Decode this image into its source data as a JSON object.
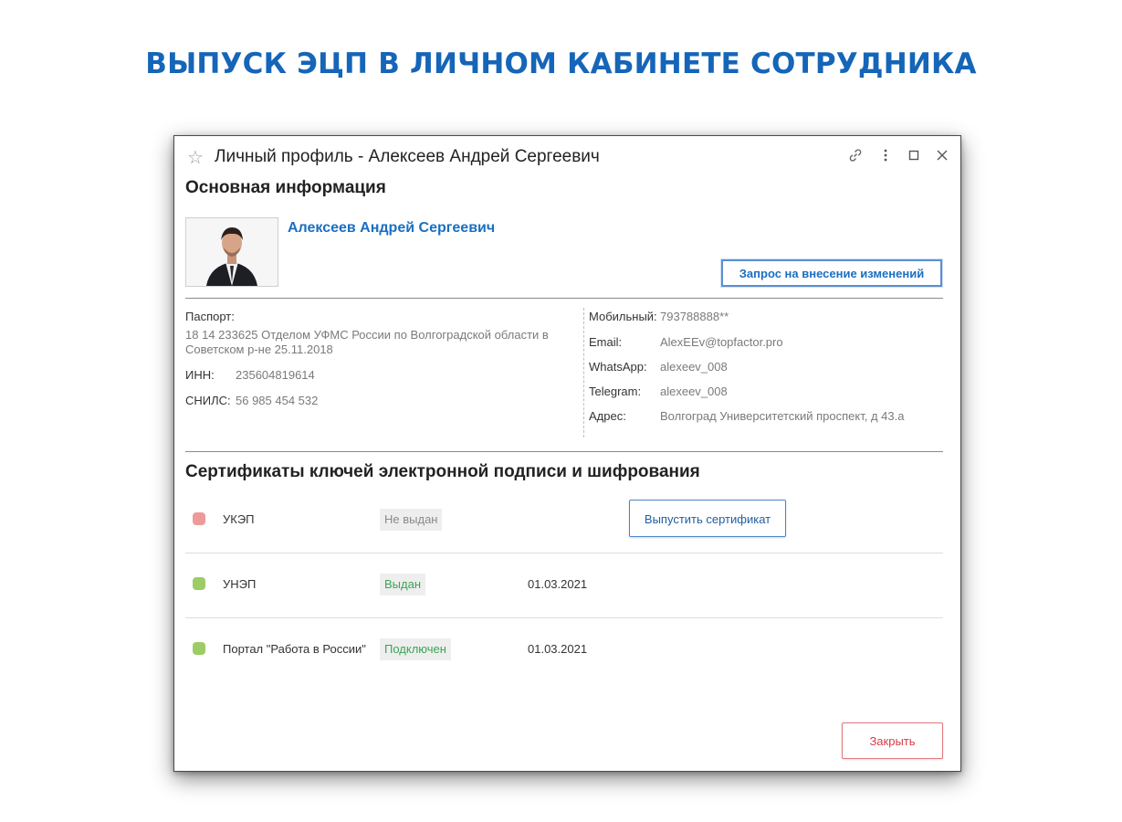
{
  "page": {
    "headline": "ВЫПУСК ЭЦП В ЛИЧНОМ КАБИНЕТЕ СОТРУДНИКА"
  },
  "window": {
    "title": "Личный профиль - Алексеев Андрей Сергеевич",
    "icons": [
      "star-icon",
      "link-icon",
      "more-vertical-icon",
      "maximize-icon",
      "close-icon"
    ]
  },
  "main_info": {
    "heading": "Основная информация",
    "employee_name": "Алексеев Андрей Сергеевич",
    "request_button": "Запрос на внесение изменений"
  },
  "details_left": {
    "passport_label": "Паспорт:",
    "passport_value": "18 14 233625 Отделом УФМС России по Волгоградской области в Советском р-не 25.11.2018",
    "inn_label": "ИНН:",
    "inn_value": "235604819614",
    "snils_label": "СНИЛС:",
    "snils_value": "56 985 454 532"
  },
  "details_right": {
    "mobile_label": "Мобильный:",
    "mobile_value": "793788888**",
    "email_label": "Email:",
    "email_value": "AlexEEv@topfactor.pro",
    "whatsapp_label": "WhatsApp:",
    "whatsapp_value": "alexeev_008",
    "telegram_label": "Telegram:",
    "telegram_value": "alexeev_008",
    "address_label": "Адрес:",
    "address_value": "Волгоград Университетский проспект, д 43.а"
  },
  "certificates": {
    "heading": "Сертификаты ключей электронной подписи и шифрования",
    "rows": [
      {
        "name": "УКЭП",
        "status": "Не выдан",
        "date": "",
        "status_color": "#ef9a9a",
        "status_text_color": "#8a8a8a"
      },
      {
        "name": "УНЭП",
        "status": "Выдан",
        "date": "01.03.2021",
        "status_color": "#9ccc65",
        "status_text_color": "#3aa655"
      },
      {
        "name": "Портал \"Работа в России\"",
        "status": "Подключен",
        "date": "01.03.2021",
        "status_color": "#9ccc65",
        "status_text_color": "#3aa655"
      }
    ],
    "issue_button": "Выпустить сертификат"
  },
  "footer": {
    "close_button": "Закрыть"
  },
  "colors": {
    "accent_blue": "#1565b8",
    "link_blue": "#1a6fc2",
    "close_red": "#d63d47"
  }
}
